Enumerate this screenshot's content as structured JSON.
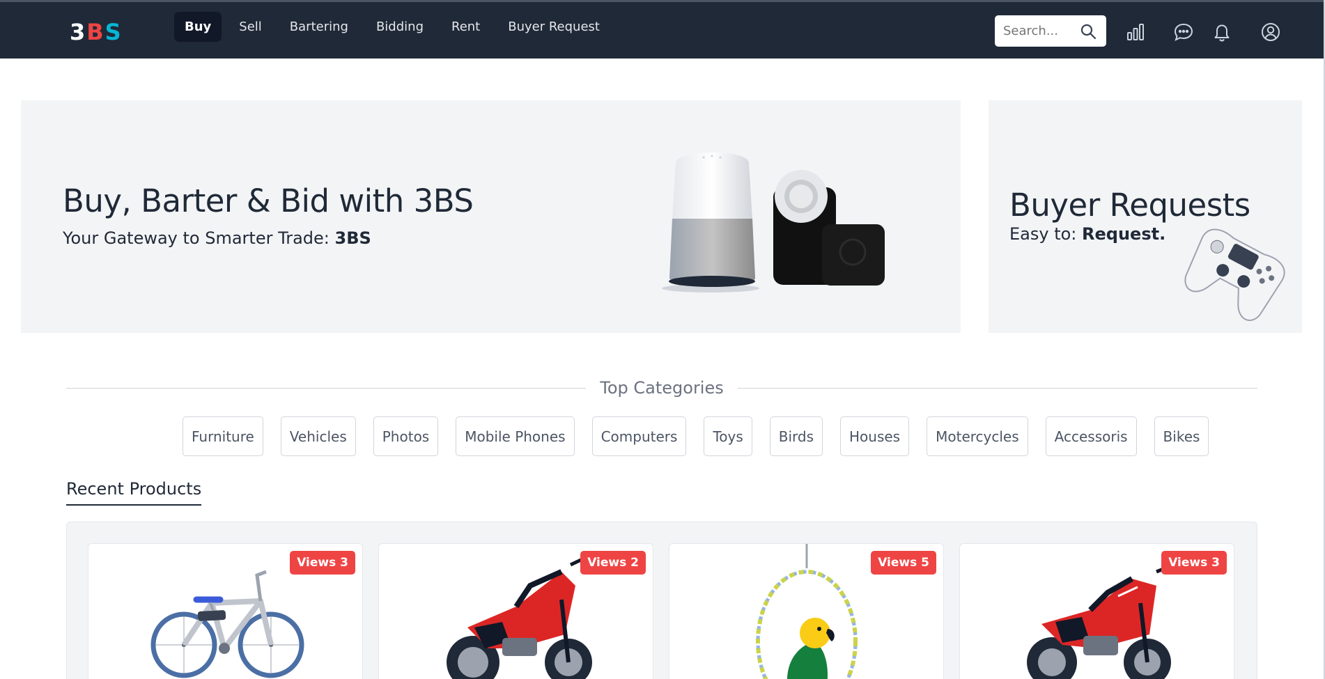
{
  "brand": {
    "letters": [
      "3",
      "B",
      "S"
    ],
    "colors": [
      "#ffffff",
      "#ef4444",
      "#06b6d4"
    ]
  },
  "nav": {
    "items": [
      {
        "label": "Buy",
        "active": true
      },
      {
        "label": "Sell",
        "active": false
      },
      {
        "label": "Bartering",
        "active": false
      },
      {
        "label": "Bidding",
        "active": false
      },
      {
        "label": "Rent",
        "active": false
      },
      {
        "label": "Buyer Request",
        "active": false
      }
    ],
    "search_placeholder": "Search...",
    "icons": [
      "search-icon",
      "stats-icon",
      "chat-icon",
      "bell-icon",
      "user-icon"
    ]
  },
  "hero": {
    "title": "Buy, Barter & Bid with 3BS",
    "subtitle_prefix": "Your Gateway to Smarter Trade: ",
    "subtitle_bold": "3BS"
  },
  "buyer_requests": {
    "title": "Buyer Requests",
    "subtitle_prefix": "Easy to: ",
    "subtitle_bold": "Request."
  },
  "categories": {
    "title": "Top Categories",
    "items": [
      "Furniture",
      "Vehicles",
      "Photos",
      "Mobile Phones",
      "Computers",
      "Toys",
      "Birds",
      "Houses",
      "Motercycles",
      "Accessoris",
      "Bikes"
    ]
  },
  "recent": {
    "title": "Recent Products",
    "products": [
      {
        "views": "Views 3",
        "image": "bicycle"
      },
      {
        "views": "Views 2",
        "image": "motorcycle"
      },
      {
        "views": "Views 5",
        "image": "parrot"
      },
      {
        "views": "Views 3",
        "image": "motorcycle"
      }
    ]
  },
  "colors": {
    "nav_bg": "#1f2937",
    "badge": "#ef4444",
    "panel": "#f3f4f6"
  }
}
